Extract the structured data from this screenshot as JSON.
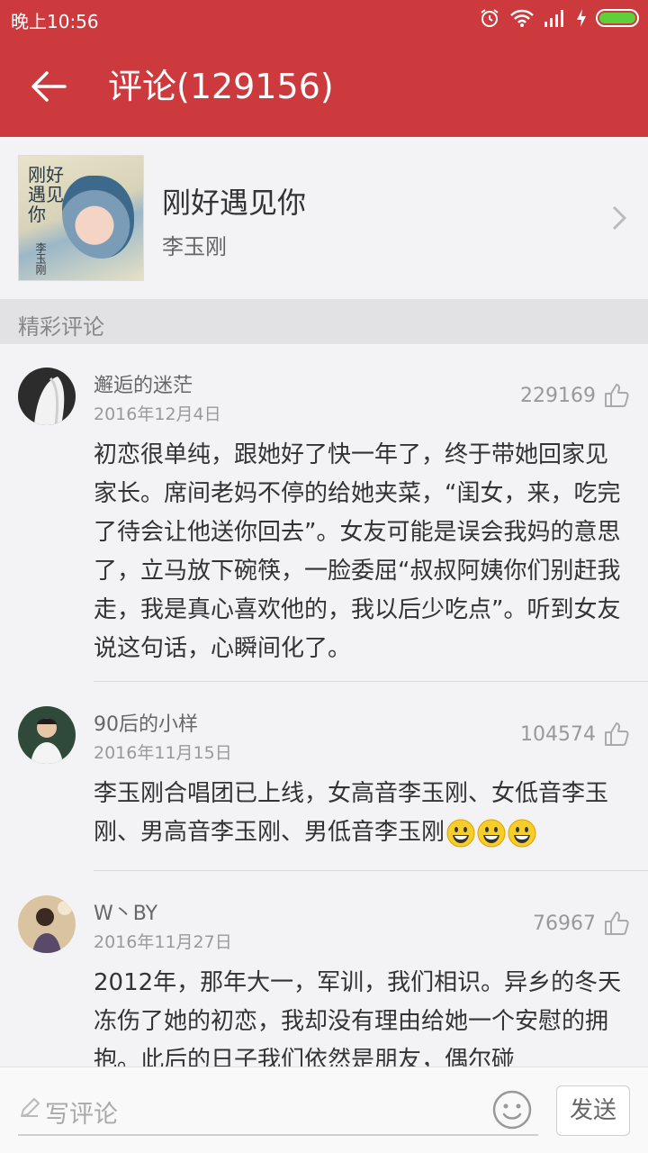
{
  "status_bar": {
    "time": "晚上10:56"
  },
  "header": {
    "title": "评论(129156)"
  },
  "song": {
    "title": "刚好遇见你",
    "artist": "李玉刚",
    "cover_title": "刚好遇见你",
    "cover_artist": "李玉刚"
  },
  "section": {
    "label": "精彩评论"
  },
  "comments": [
    {
      "user": "邂逅的迷茫",
      "date": "2016年12月4日",
      "likes": "229169",
      "text": "初恋很单纯，跟她好了快一年了，终于带她回家见家长。席间老妈不停的给她夹菜，“闺女，来，吃完了待会让他送你回去”。女友可能是误会我妈的意思了，立马放下碗筷，一脸委屈“叔叔阿姨你们别赶我走，我是真心喜欢他的，我以后少吃点”。听到女友说这句话，心瞬间化了。"
    },
    {
      "user": "90后的小样",
      "date": "2016年11月15日",
      "likes": "104574",
      "text": "李玉刚合唱团已上线，女高音李玉刚、女低音李玉刚、男高音李玉刚、男低音李玉刚"
    },
    {
      "user": "W丶BY",
      "date": "2016年11月27日",
      "likes": "76967",
      "text": "2012年，那年大一，军训，我们相识。异乡的冬天冻伤了她的初恋，我却没有理由给她一个安慰的拥抱。此后的日子我们依然是朋友，偶尔碰"
    }
  ],
  "bottom_bar": {
    "placeholder": "写评论",
    "send_label": "发送"
  },
  "colors": {
    "accent": "#cd3a3d",
    "battery": "#5ed03a"
  }
}
